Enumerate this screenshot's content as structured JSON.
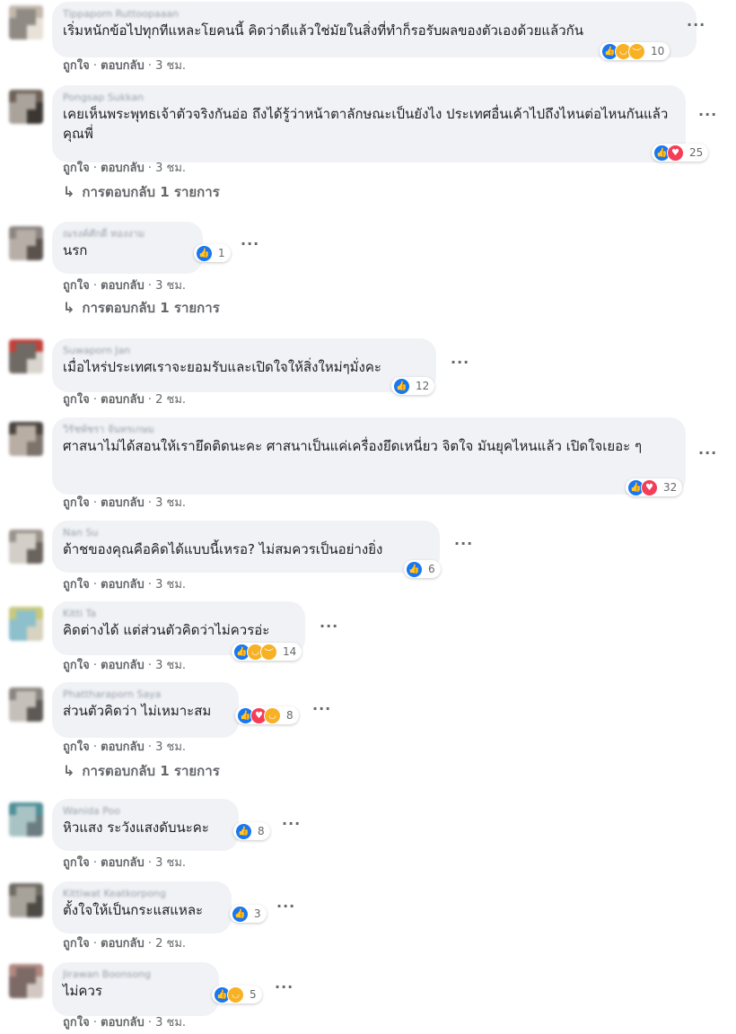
{
  "comments": [
    {
      "author": "Tippaporn Ruttoopaaan",
      "text": "เริ่มหนักข้อไปทุกทีแหละโยคนนี้ คิดว่าดีแล้วใช่มัยในสิ่งที่ทำก็รอรับผลของตัวเองด้วยแล้วกัน",
      "reactions": [
        "like",
        "haha",
        "sad"
      ],
      "reaction_count": "10",
      "like_label": "ถูกใจ",
      "reply_label": "ตอบกลับ",
      "time": "3 ชม.",
      "replies": ""
    },
    {
      "author": "Pongsap Sukkan",
      "text": "เคยเห็นพระพุทธเจ้าตัวจริงกันอ่อ ถึงได้รู้ว่าหน้าตาลักษณะเป็นยังไง ประเทศอื่นเค้าไปถึงไหนต่อไหนกันแล้วคุณพี่",
      "reactions": [
        "like",
        "love"
      ],
      "reaction_count": "25",
      "like_label": "ถูกใจ",
      "reply_label": "ตอบกลับ",
      "time": "3 ชม.",
      "replies": "การตอบกลับ 1 รายการ"
    },
    {
      "author": "ณรงค์ศักดิ์ ทองงาม",
      "text": "นรก",
      "reactions": [
        "like"
      ],
      "reaction_count": "1",
      "like_label": "ถูกใจ",
      "reply_label": "ตอบกลับ",
      "time": "3 ชม.",
      "replies": "การตอบกลับ 1 รายการ"
    },
    {
      "author": "Suwaporn Jan",
      "text": "เมื่อไหร่ประเทศเราจะยอมรับและเปิดใจให้สิ่งใหม่ๆมั่งคะ",
      "reactions": [
        "like"
      ],
      "reaction_count": "12",
      "like_label": "ถูกใจ",
      "reply_label": "ตอบกลับ",
      "time": "2 ชม.",
      "replies": ""
    },
    {
      "author": "วิรัชพัชรา จันทรเกษม",
      "text": "ศาสนาไม่ได้สอนให้เรายึดติดนะคะ ศาสนาเป็นแค่เครื่องยึดเหนี่ยว จิตใจ มันยุคไหนแล้ว เปิดใจเยอะ ๆ",
      "reactions": [
        "like",
        "love"
      ],
      "reaction_count": "32",
      "like_label": "ถูกใจ",
      "reply_label": "ตอบกลับ",
      "time": "3 ชม.",
      "replies": ""
    },
    {
      "author": "Nan Su",
      "text": "ต้าชของคุณคือคิดได้แบบนี้เหรอ? ไม่สมควรเป็นอย่างยิ่ง",
      "reactions": [
        "like"
      ],
      "reaction_count": "6",
      "like_label": "ถูกใจ",
      "reply_label": "ตอบกลับ",
      "time": "3 ชม.",
      "replies": ""
    },
    {
      "author": "Kitti Ta",
      "text": "คิดต่างได้ แต่ส่วนตัวคิดว่าไม่ควรอ่ะ",
      "reactions": [
        "like",
        "haha",
        "sad"
      ],
      "reaction_count": "14",
      "like_label": "ถูกใจ",
      "reply_label": "ตอบกลับ",
      "time": "3 ชม.",
      "replies": ""
    },
    {
      "author": "Phattharaporn Saya",
      "text": "ส่วนตัวคิดว่า ไม่เหมาะสม",
      "reactions": [
        "like",
        "love",
        "haha"
      ],
      "reaction_count": "8",
      "like_label": "ถูกใจ",
      "reply_label": "ตอบกลับ",
      "time": "3 ชม.",
      "replies": "การตอบกลับ 1 รายการ"
    },
    {
      "author": "Wanida Poo",
      "text": "หิวแสง ระวังแสงดับนะคะ",
      "reactions": [
        "like"
      ],
      "reaction_count": "8",
      "like_label": "ถูกใจ",
      "reply_label": "ตอบกลับ",
      "time": "3 ชม.",
      "replies": ""
    },
    {
      "author": "Kittiwat Keatkorpong",
      "text": "ตั้งใจให้เป็นกระแสแหละ",
      "reactions": [
        "like"
      ],
      "reaction_count": "3",
      "like_label": "ถูกใจ",
      "reply_label": "ตอบกลับ",
      "time": "2 ชม.",
      "replies": ""
    },
    {
      "author": "Jirawan Boonsong",
      "text": "ไม่ควร",
      "reactions": [
        "like",
        "haha"
      ],
      "reaction_count": "5",
      "like_label": "ถูกใจ",
      "reply_label": "ตอบกลับ",
      "time": "3 ชม.",
      "replies": ""
    }
  ],
  "more_icon": "more-dots-icon",
  "reply_arrow_icon": "reply-arrow-icon",
  "colors": {
    "bubble": "#f0f2f5",
    "like": "#1877f2",
    "love": "#f33e58",
    "haha": "#f7b125",
    "meta_text": "#65676b"
  }
}
